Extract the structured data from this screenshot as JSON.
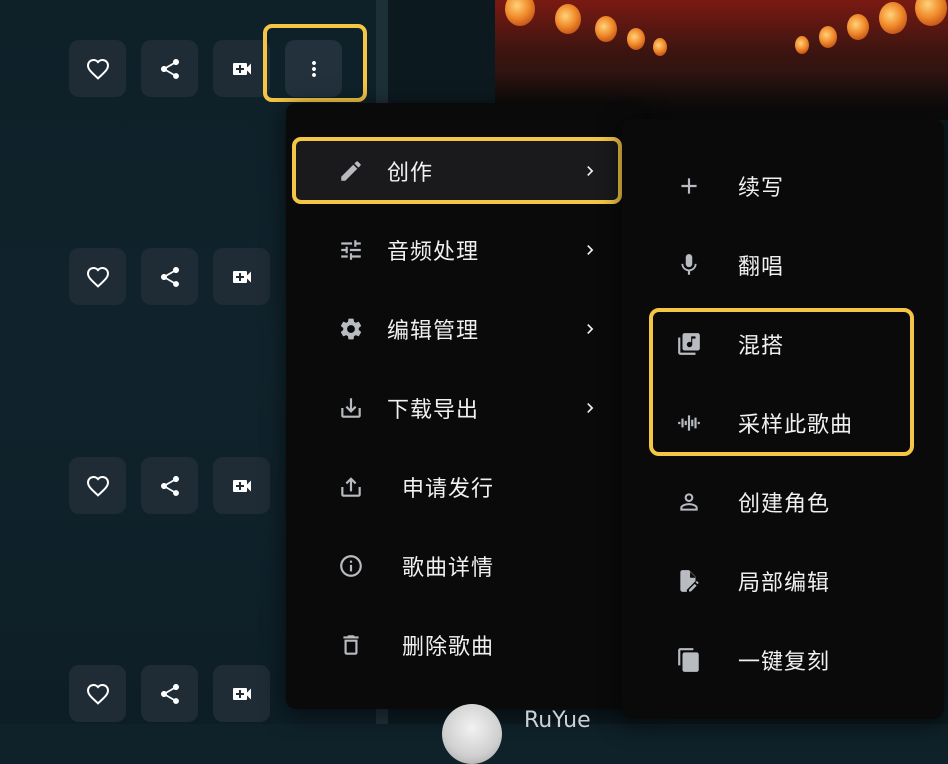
{
  "menu": {
    "items": [
      {
        "label": "创作",
        "icon": "pencil-icon",
        "submenu": true,
        "active": true
      },
      {
        "label": "音频处理",
        "icon": "tune-icon",
        "submenu": true
      },
      {
        "label": "编辑管理",
        "icon": "gear-icon",
        "submenu": true
      },
      {
        "label": "下载导出",
        "icon": "download-icon",
        "submenu": true
      },
      {
        "label": "申请发行",
        "icon": "upload-icon",
        "submenu": false
      },
      {
        "label": "歌曲详情",
        "icon": "info-icon",
        "submenu": false
      },
      {
        "label": "删除歌曲",
        "icon": "trash-icon",
        "submenu": false
      }
    ]
  },
  "submenu": {
    "items": [
      {
        "label": "续写",
        "icon": "plus-icon"
      },
      {
        "label": "翻唱",
        "icon": "microphone-icon"
      },
      {
        "label": "混搭",
        "icon": "music-library-icon"
      },
      {
        "label": "采样此歌曲",
        "icon": "waveform-icon"
      },
      {
        "label": "创建角色",
        "icon": "person-icon"
      },
      {
        "label": "局部编辑",
        "icon": "file-edit-icon"
      },
      {
        "label": "一键复刻",
        "icon": "copy-icon"
      }
    ]
  },
  "action_rows": [
    {
      "buttons": [
        "heart-icon",
        "share-icon",
        "video-add-icon",
        "more-vertical-icon"
      ]
    },
    {
      "buttons": [
        "heart-icon",
        "share-icon",
        "video-add-icon"
      ]
    },
    {
      "buttons": [
        "heart-icon",
        "share-icon",
        "video-add-icon"
      ]
    },
    {
      "buttons": [
        "heart-icon",
        "share-icon",
        "video-add-icon"
      ]
    }
  ],
  "colors": {
    "highlight": "#f5c545",
    "menu_bg": "#0a0a0b",
    "button_bg": "#1f2b35",
    "page_bg": "#0f2129"
  },
  "peek": {
    "author_partial": "RuYue"
  }
}
